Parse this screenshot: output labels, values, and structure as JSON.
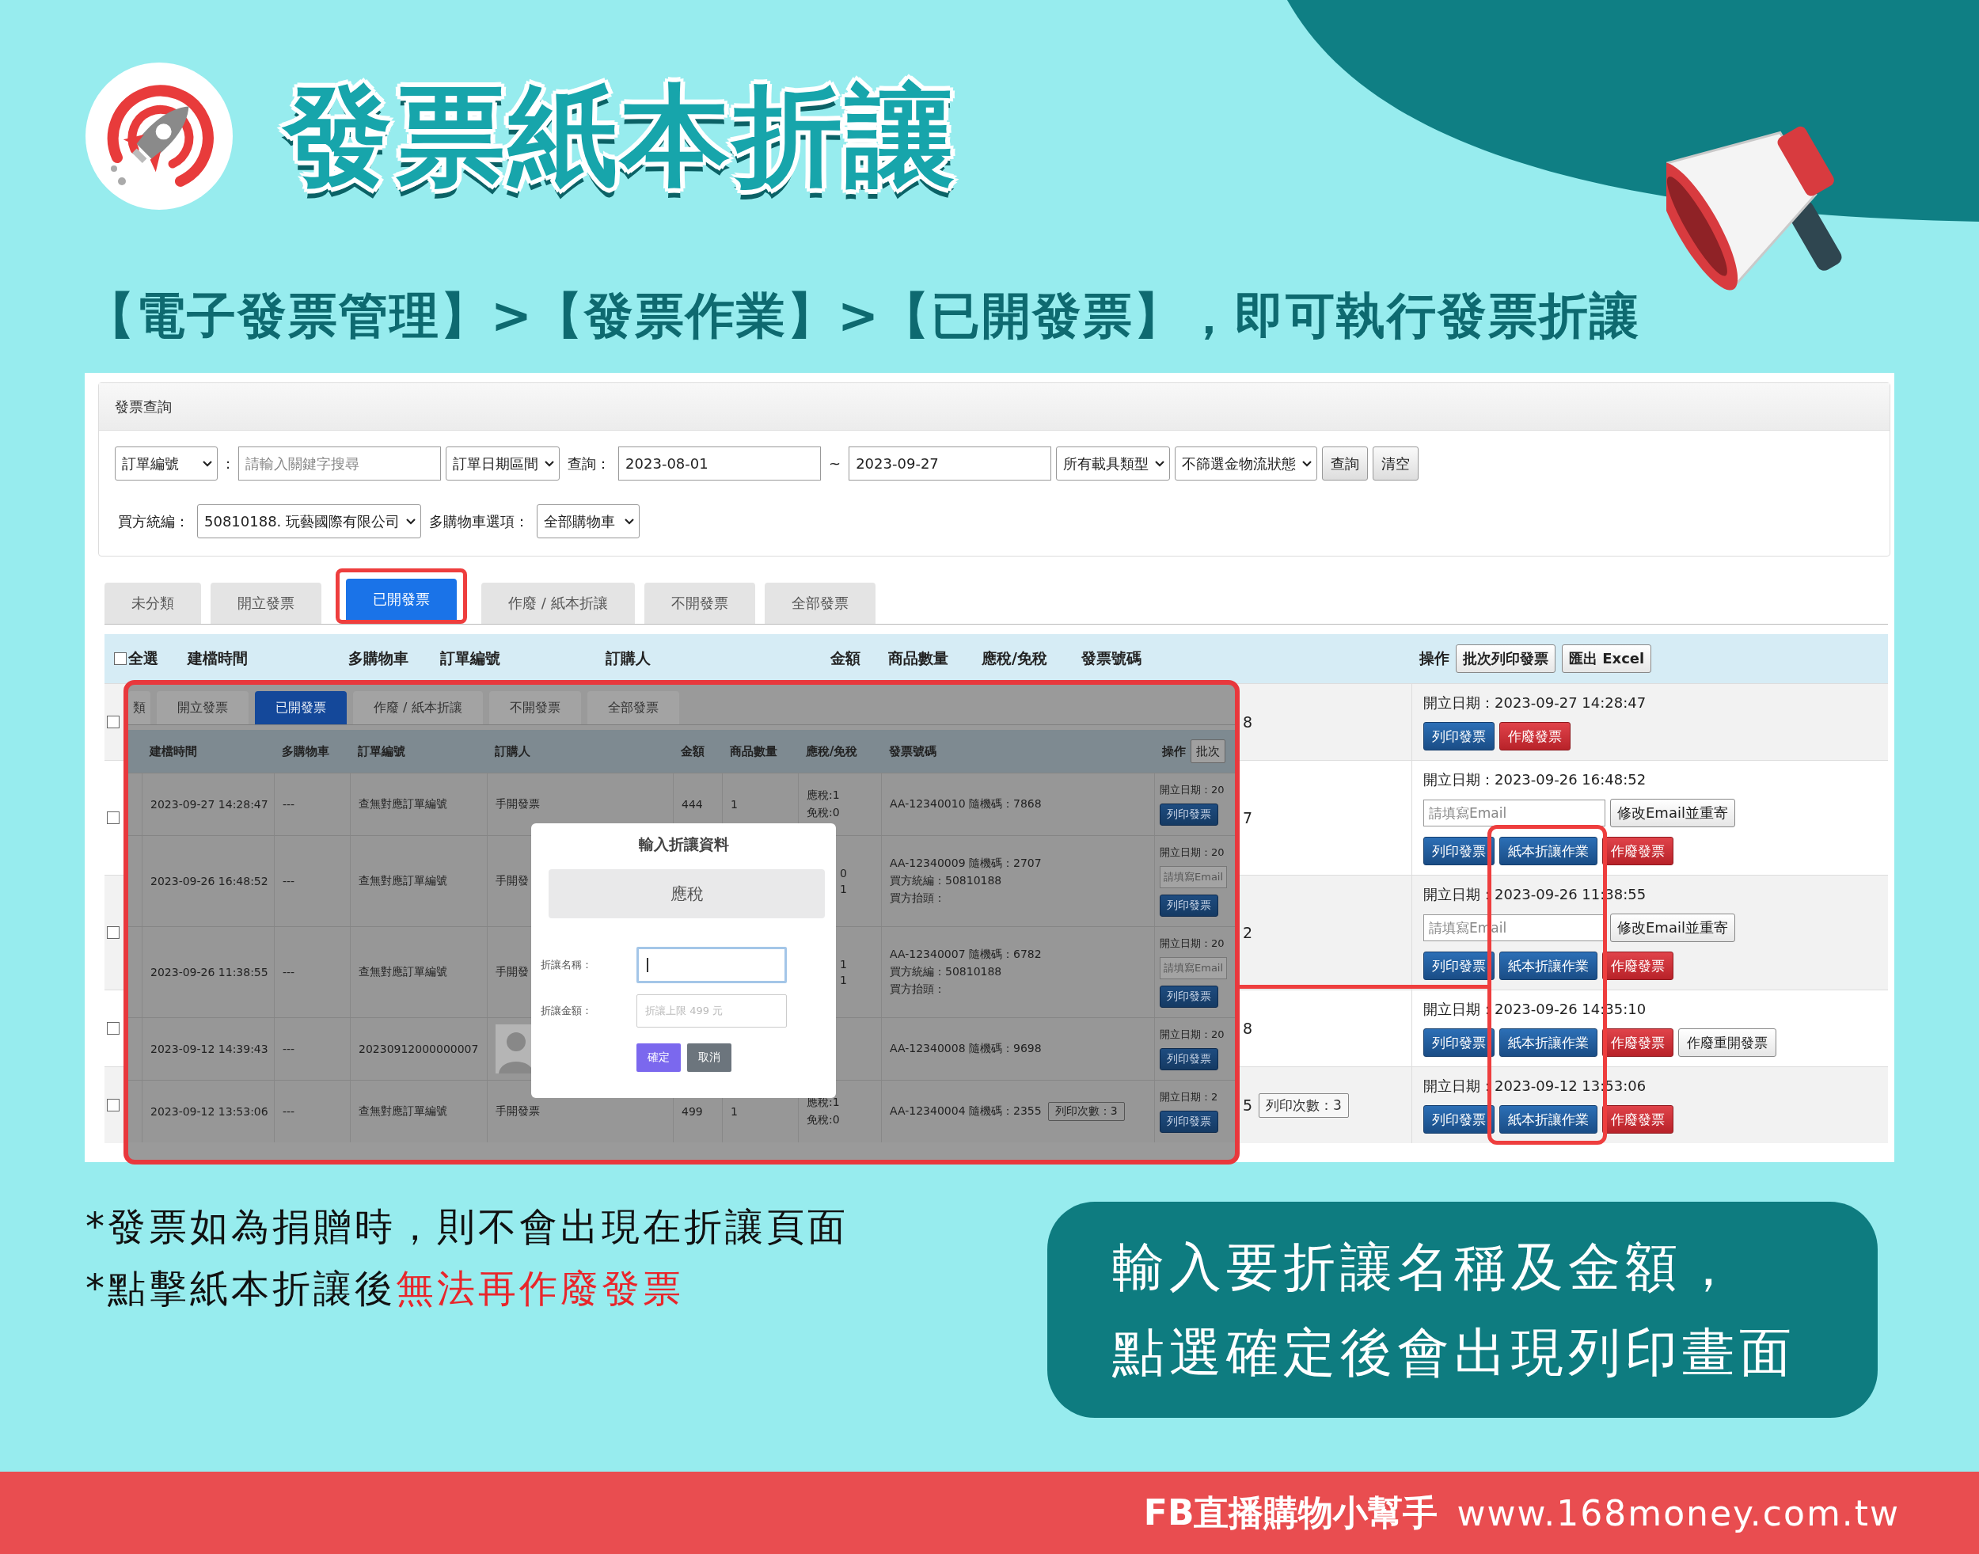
{
  "title": "發票紙本折讓",
  "breadcrumb": "【電子發票管理】>【發票作業】>【已開發票】，即可執行發票折讓",
  "screenshot": {
    "query": {
      "heading": "發票查詢",
      "search_row": [
        {
          "kind": "select",
          "value": "訂單編號"
        },
        {
          "kind": "label",
          "value": ":"
        },
        {
          "kind": "input",
          "placeholder": "請輸入關鍵字搜尋"
        },
        {
          "kind": "select",
          "value": "訂單日期區間"
        },
        {
          "kind": "label",
          "value": "查詢："
        },
        {
          "kind": "input",
          "value": "2023-08-01"
        },
        {
          "kind": "label",
          "value": "~"
        },
        {
          "kind": "input",
          "value": "2023-09-27"
        },
        {
          "kind": "select",
          "value": "所有載具類型"
        },
        {
          "kind": "select",
          "value": "不篩選金物流狀態"
        },
        {
          "kind": "button",
          "value": "查詢"
        },
        {
          "kind": "button",
          "value": "清空"
        }
      ],
      "buyer_row": [
        {
          "kind": "label",
          "value": "買方統編："
        },
        {
          "kind": "select",
          "value": "50810188. 玩藝國際有限公司"
        },
        {
          "kind": "label",
          "value": "多購物車選項："
        },
        {
          "kind": "select",
          "value": "全部購物車"
        }
      ]
    },
    "tabs": [
      {
        "label": "未分類",
        "selected": false,
        "annotated": false
      },
      {
        "label": "開立發票",
        "selected": false,
        "annotated": false
      },
      {
        "label": "已開發票",
        "selected": true,
        "annotated": true
      },
      {
        "label": "作廢 / 紙本折讓",
        "selected": false,
        "annotated": false
      },
      {
        "label": "不開發票",
        "selected": false,
        "annotated": false
      },
      {
        "label": "全部發票",
        "selected": false,
        "annotated": false
      }
    ],
    "table": {
      "select_all": {
        "label": "全選",
        "checked": false
      },
      "columns": [
        "建檔時間",
        "多購物車",
        "訂單編號",
        "訂購人",
        "金額",
        "商品數量",
        "應稅/免稅",
        "發票號碼"
      ],
      "action_column": {
        "label": "操作",
        "buttons": [
          "批次列印發票",
          "匯出 Excel"
        ]
      },
      "rows": [
        {
          "checked": false,
          "tail": "8",
          "opened": "開立日期：2023-09-27 14:28:47",
          "actions": [
            {
              "kind": "print",
              "label": "列印發票"
            },
            {
              "kind": "void",
              "label": "作廢發票"
            }
          ]
        },
        {
          "checked": false,
          "tail": "7",
          "opened": "開立日期：2023-09-26 16:48:52",
          "email": {
            "placeholder": "請填寫Email",
            "button": "修改Email並重寄"
          },
          "actions": [
            {
              "kind": "print",
              "label": "列印發票"
            },
            {
              "kind": "allowance",
              "label": "紙本折讓作業"
            },
            {
              "kind": "void",
              "label": "作廢發票"
            }
          ]
        },
        {
          "checked": false,
          "tail": "2",
          "opened": "開立日期：2023-09-26 11:38:55",
          "email": {
            "placeholder": "請填寫Email",
            "button": "修改Email並重寄"
          },
          "actions": [
            {
              "kind": "print",
              "label": "列印發票"
            },
            {
              "kind": "allowance",
              "label": "紙本折讓作業"
            },
            {
              "kind": "void",
              "label": "作廢發票"
            }
          ]
        },
        {
          "checked": false,
          "tail": "8",
          "opened": "開立日期：2023-09-26 14:35:10",
          "actions": [
            {
              "kind": "print",
              "label": "列印發票"
            },
            {
              "kind": "allowance",
              "label": "紙本折讓作業"
            },
            {
              "kind": "void",
              "label": "作廢發票"
            },
            {
              "kind": "reissue",
              "label": "作廢重開發票"
            }
          ]
        },
        {
          "checked": false,
          "tail": "5",
          "print_count": "列印次數：3",
          "opened": "開立日期：2023-09-12 13:53:06",
          "actions": [
            {
              "kind": "print",
              "label": "列印發票"
            },
            {
              "kind": "allowance",
              "label": "紙本折讓作業"
            },
            {
              "kind": "void",
              "label": "作廢發票"
            }
          ]
        }
      ]
    },
    "zoomed": {
      "tabs": [
        {
          "label": "類",
          "selected": false
        },
        {
          "label": "開立發票",
          "selected": false
        },
        {
          "label": "已開發票",
          "selected": true
        },
        {
          "label": "作廢 / 紙本折讓",
          "selected": false
        },
        {
          "label": "不開發票",
          "selected": false
        },
        {
          "label": "全部發票",
          "selected": false
        }
      ],
      "columns": [
        "建檔時間",
        "多購物車",
        "訂單編號",
        "訂購人",
        "金額",
        "商品數量",
        "應稅/免稅",
        "發票號碼"
      ],
      "action_column": {
        "label": "操作",
        "button": "批次"
      },
      "rows": [
        {
          "created": "2023-09-27 14:28:47",
          "cart": "---",
          "order": "查無對應訂單編號",
          "buyer": {
            "kind": "text",
            "value": "手開發票"
          },
          "amount": "444",
          "qty": "1",
          "tax": {
            "kind": "full",
            "lines": [
              "應稅:1",
              "免稅:0"
            ]
          },
          "invoice": [
            "AA-12340010 隨機碼：7868"
          ],
          "op": {
            "date": "開立日期：20",
            "button": "列印發票"
          }
        },
        {
          "created": "2023-09-26 16:48:52",
          "cart": "---",
          "order": "查無對應訂單編號",
          "buyer": {
            "kind": "text",
            "value": "手開發"
          },
          "tax": {
            "kind": "tail",
            "lines": [
              "0",
              "1"
            ]
          },
          "invoice": [
            "AA-12340009 隨機碼：2707",
            "買方統編：50810188",
            "買方抬頭："
          ],
          "op": {
            "date": "開立日期：20",
            "email": "請填寫Email",
            "button": "列印發票"
          }
        },
        {
          "created": "2023-09-26 11:38:55",
          "cart": "---",
          "order": "查無對應訂單編號",
          "buyer": {
            "kind": "text",
            "value": "手開發"
          },
          "tax": {
            "kind": "tail",
            "lines": [
              "1",
              "1"
            ]
          },
          "invoice": [
            "AA-12340007 隨機碼：6782",
            "買方統編：50810188",
            "買方抬頭："
          ],
          "op": {
            "date": "開立日期：20",
            "email": "請填寫Email",
            "button": "列印發票"
          }
        },
        {
          "created": "2023-09-12 14:39:43",
          "cart": "---",
          "order": "20230912000000007",
          "buyer": {
            "kind": "avatar"
          },
          "invoice": [
            "AA-12340008 隨機碼：9698"
          ],
          "op": {
            "date": "開立日期：20",
            "button": "列印發票"
          }
        },
        {
          "created": "2023-09-12 13:53:06",
          "cart": "---",
          "order": "查無對應訂單編號",
          "buyer": {
            "kind": "text",
            "value": "手開發票"
          },
          "amount": "499",
          "qty": "1",
          "tax": {
            "kind": "full",
            "lines": [
              "應稅:1",
              "免稅:0"
            ]
          },
          "invoice": [
            "AA-12340004 隨機碼：2355"
          ],
          "print_count": "列印次數：3",
          "op": {
            "date": "開立日期：2",
            "button": "列印發票"
          }
        }
      ],
      "dialog": {
        "title": "輸入折讓資料",
        "tax_type": "應稅",
        "fields": [
          {
            "label": "折讓名稱：",
            "focused": true
          },
          {
            "label": "折讓金額：",
            "placeholder": "折讓上限 499 元",
            "focused": false
          }
        ],
        "buttons": [
          {
            "kind": "primary",
            "label": "確定"
          },
          {
            "kind": "secondary",
            "label": "取消"
          }
        ]
      }
    }
  },
  "notes": [
    {
      "segments": [
        {
          "text": "*發票如為捐贈時，則不會出現在折讓頁面",
          "emphasis": false
        }
      ]
    },
    {
      "segments": [
        {
          "text": "*點擊紙本折讓後",
          "emphasis": false
        },
        {
          "text": "無法再作廢發票",
          "emphasis": true
        }
      ]
    }
  ],
  "callout": [
    "輸入要折讓名稱及金額，",
    "點選確定後會出現列印畫面"
  ],
  "footer": {
    "brand": "FB直播購物小幫手",
    "url": "www.168money.com.tw"
  }
}
